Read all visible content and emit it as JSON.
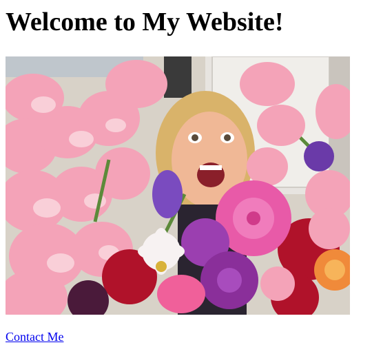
{
  "page": {
    "heading": "Welcome to My Website!",
    "link_label": "Contact Me"
  },
  "image": {
    "description_icon": "photo-woman-with-flowers",
    "colors": {
      "gladiolus_pink": "#f4a3b8",
      "gladiolus_light": "#f9cfd8",
      "dahlia_magenta": "#e85aa8",
      "dahlia_purple": "#8a2f9a",
      "dahlia_red": "#b0122a",
      "cosmos_white": "#f7f2f2",
      "hair_blonde": "#d9b36a",
      "skin": "#f0b896",
      "door_gray": "#e7e4e0"
    }
  },
  "link": {
    "color": "#0000ee"
  }
}
